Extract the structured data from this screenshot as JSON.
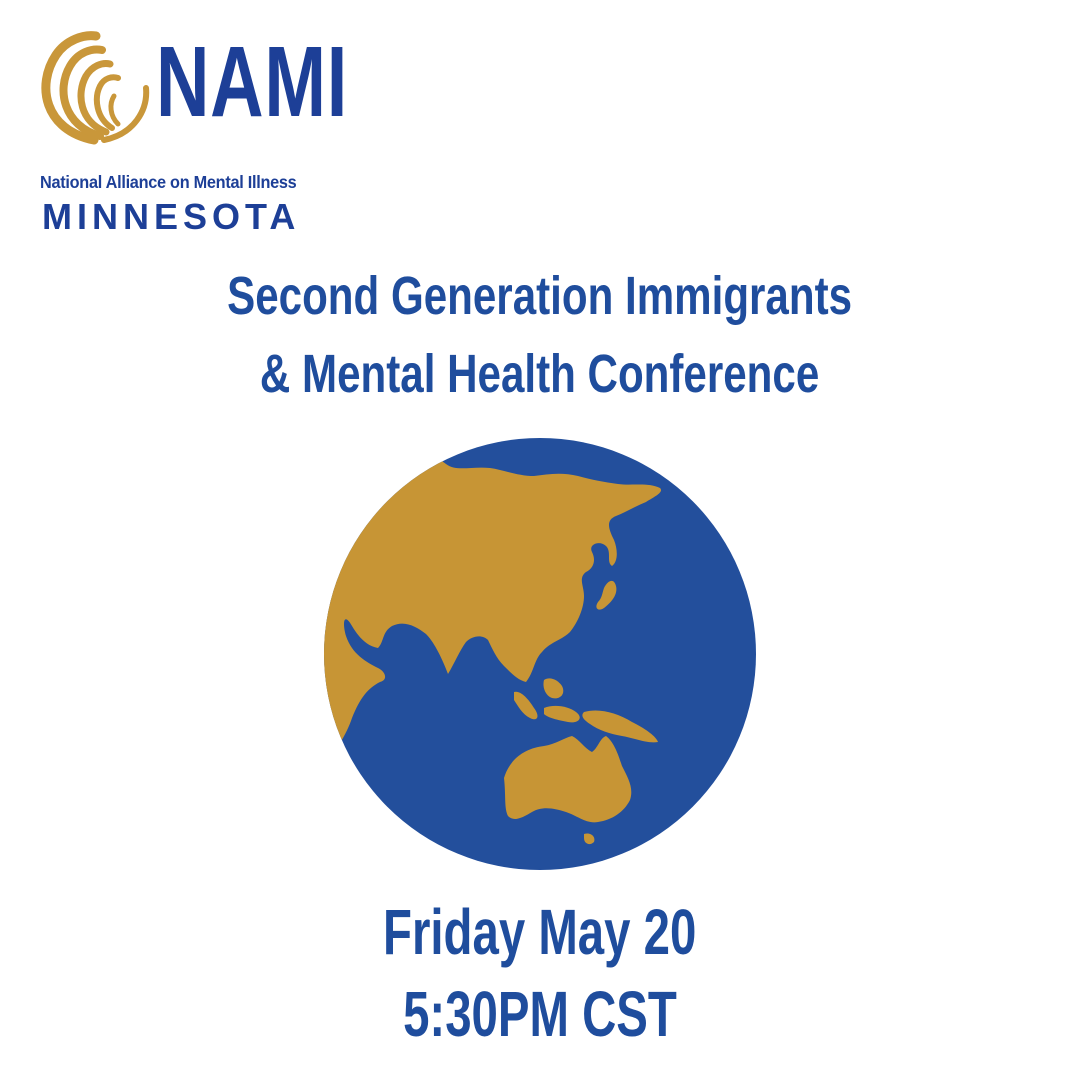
{
  "logo": {
    "word": "NAMI",
    "tagline": "National Alliance on Mental Illness",
    "state": "MINNESOTA"
  },
  "event": {
    "title_line1": "Second Generation Immigrants",
    "title_line2": "& Mental Health Conference",
    "date": "Friday May 20",
    "time": "5:30PM CST"
  },
  "colors": {
    "brand_blue": "#1d3f97",
    "text_blue": "#1f4d9d",
    "gold": "#c9973a",
    "ocean": "#234f9c",
    "land": "#c79535",
    "background": "#ffffff"
  },
  "icons": {
    "logo_mark": "nami-flame-mark",
    "globe": "earth-globe-icon"
  }
}
